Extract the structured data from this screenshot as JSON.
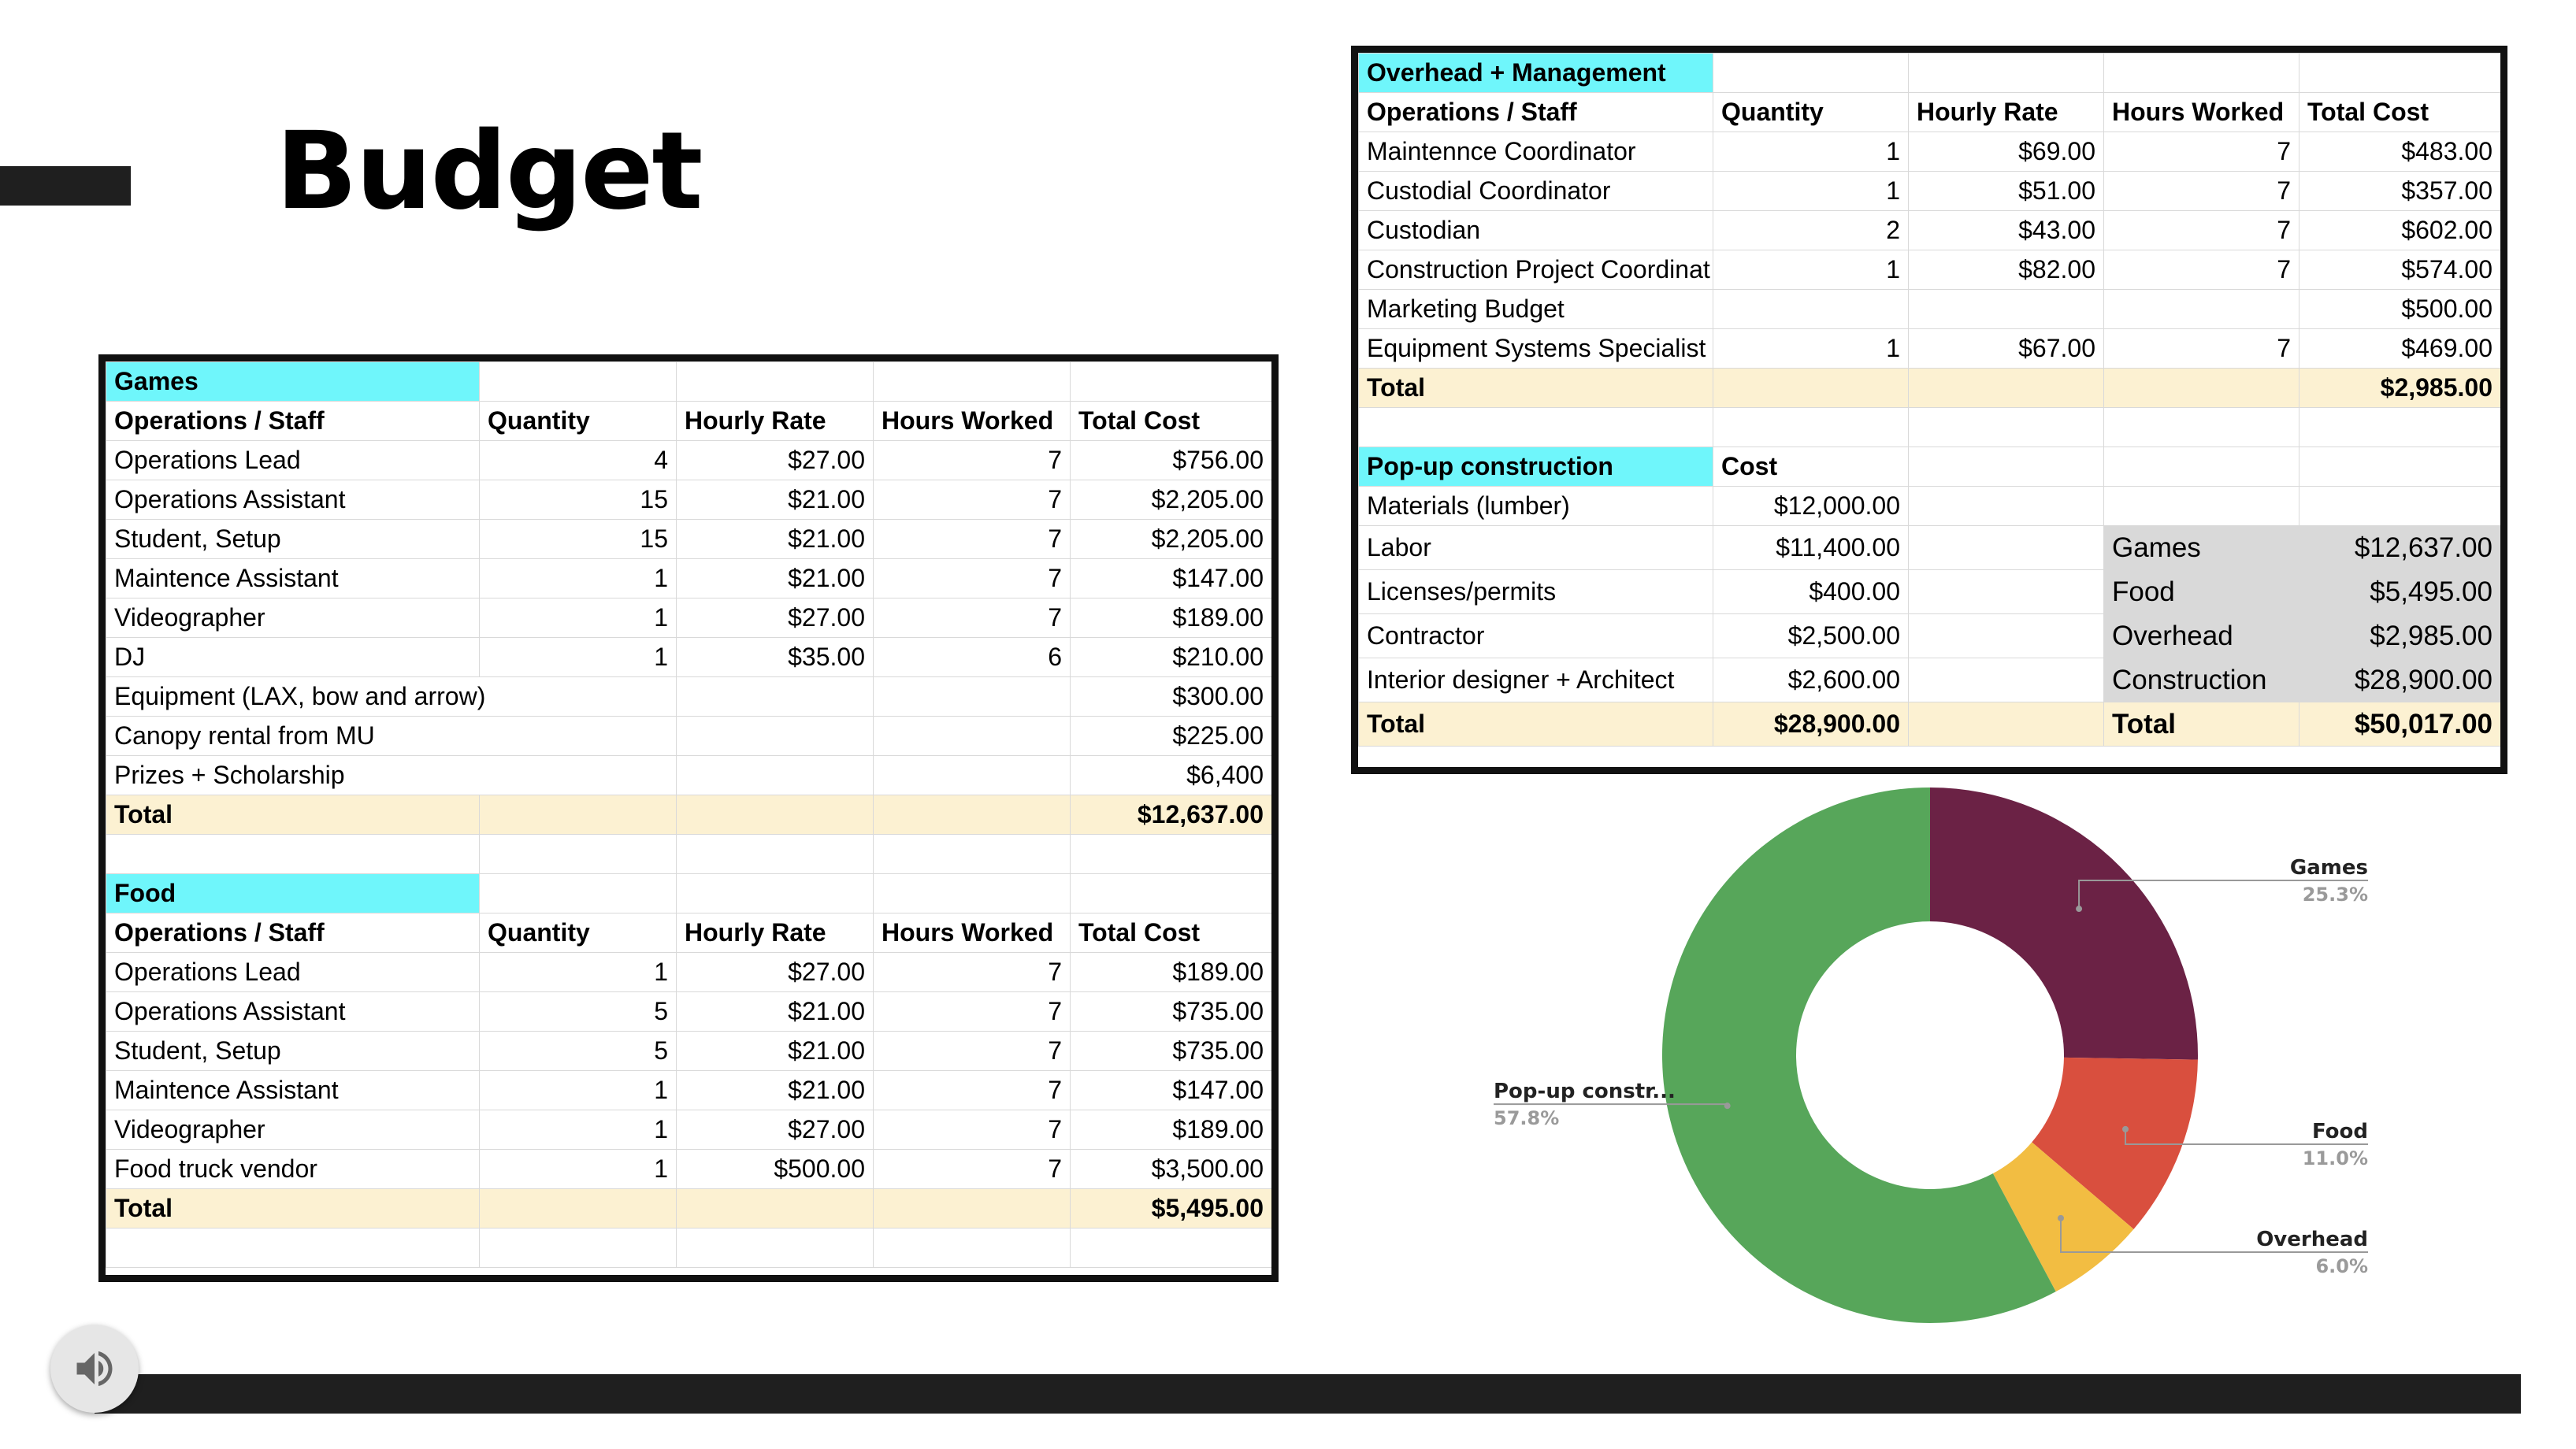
{
  "slide": {
    "title": "Budget"
  },
  "games": {
    "header": "Games",
    "columns": [
      "Operations / Staff",
      "Quantity",
      "Hourly Rate",
      "Hours Worked",
      "Total Cost"
    ],
    "rows": [
      [
        "Operations Lead",
        "4",
        "$27.00",
        "7",
        "$756.00"
      ],
      [
        "Operations Assistant",
        "15",
        "$21.00",
        "7",
        "$2,205.00"
      ],
      [
        "Student, Setup",
        "15",
        "$21.00",
        "7",
        "$2,205.00"
      ],
      [
        "Maintence Assistant",
        "1",
        "$21.00",
        "7",
        "$147.00"
      ],
      [
        "Videographer",
        "1",
        "$27.00",
        "7",
        "$189.00"
      ],
      [
        "DJ",
        "1",
        "$35.00",
        "6",
        "$210.00"
      ],
      [
        "Equipment (LAX, bow and arrow)",
        "",
        "",
        "",
        "$300.00"
      ],
      [
        "Canopy rental from MU",
        "",
        "",
        "",
        "$225.00"
      ],
      [
        "Prizes + Scholarship",
        "",
        "",
        "",
        "$6,400"
      ]
    ],
    "total_label": "Total",
    "total_value": "$12,637.00"
  },
  "food": {
    "header": "Food",
    "columns": [
      "Operations / Staff",
      "Quantity",
      "Hourly Rate",
      "Hours Worked",
      "Total Cost"
    ],
    "rows": [
      [
        "Operations Lead",
        "1",
        "$27.00",
        "7",
        "$189.00"
      ],
      [
        "Operations Assistant",
        "5",
        "$21.00",
        "7",
        "$735.00"
      ],
      [
        "Student, Setup",
        "5",
        "$21.00",
        "7",
        "$735.00"
      ],
      [
        "Maintence Assistant",
        "1",
        "$21.00",
        "7",
        "$147.00"
      ],
      [
        "Videographer",
        "1",
        "$27.00",
        "7",
        "$189.00"
      ],
      [
        "Food truck vendor",
        "1",
        "$500.00",
        "7",
        "$3,500.00"
      ]
    ],
    "total_label": "Total",
    "total_value": "$5,495.00"
  },
  "overhead": {
    "header": "Overhead + Management",
    "columns": [
      "Operations / Staff",
      "Quantity",
      "Hourly Rate",
      "Hours Worked",
      "Total Cost"
    ],
    "rows": [
      [
        "Maintennce Coordinator",
        "1",
        "$69.00",
        "7",
        "$483.00"
      ],
      [
        "Custodial Coordinator",
        "1",
        "$51.00",
        "7",
        "$357.00"
      ],
      [
        "Custodian",
        "2",
        "$43.00",
        "7",
        "$602.00"
      ],
      [
        "Construction Project Coordinat",
        "1",
        "$82.00",
        "7",
        "$574.00"
      ],
      [
        "Marketing Budget",
        "",
        "",
        "",
        "$500.00"
      ],
      [
        "Equipment Systems Specialist",
        "1",
        "$67.00",
        "7",
        "$469.00"
      ]
    ],
    "total_label": "Total",
    "total_value": "$2,985.00"
  },
  "construction": {
    "header": "Pop-up construction",
    "cost_label": "Cost",
    "rows": [
      [
        "Materials (lumber)",
        "$12,000.00"
      ],
      [
        "Labor",
        "$11,400.00"
      ],
      [
        "Licenses/permits",
        "$400.00"
      ],
      [
        "Contractor",
        "$2,500.00"
      ],
      [
        "Interior designer + Architect",
        "$2,600.00"
      ]
    ],
    "total_label": "Total",
    "total_value": "$28,900.00"
  },
  "summary": {
    "rows": [
      [
        "Games",
        "$12,637.00"
      ],
      [
        "Food",
        "$5,495.00"
      ],
      [
        "Overhead",
        "$2,985.00"
      ],
      [
        "Construction",
        "$28,900.00"
      ]
    ],
    "total_label": "Total",
    "total_value": "$50,017.00"
  },
  "chart_data": {
    "type": "pie",
    "donut": true,
    "slices": [
      {
        "label": "Games",
        "percent_label": "25.3%",
        "value": 12637,
        "color": "#6b2245",
        "side": "right"
      },
      {
        "label": "Food",
        "percent_label": "11.0%",
        "value": 5495,
        "color": "#d94f3e",
        "side": "right"
      },
      {
        "label": "Overhead",
        "percent_label": "6.0%",
        "value": 2985,
        "color": "#f2bd42",
        "side": "right"
      },
      {
        "label": "Pop-up constr...",
        "percent_label": "57.8%",
        "value": 28900,
        "color": "#57a65a",
        "side": "left"
      }
    ],
    "legend": "none"
  },
  "icons": {
    "speaker": "speaker-volume-icon"
  }
}
